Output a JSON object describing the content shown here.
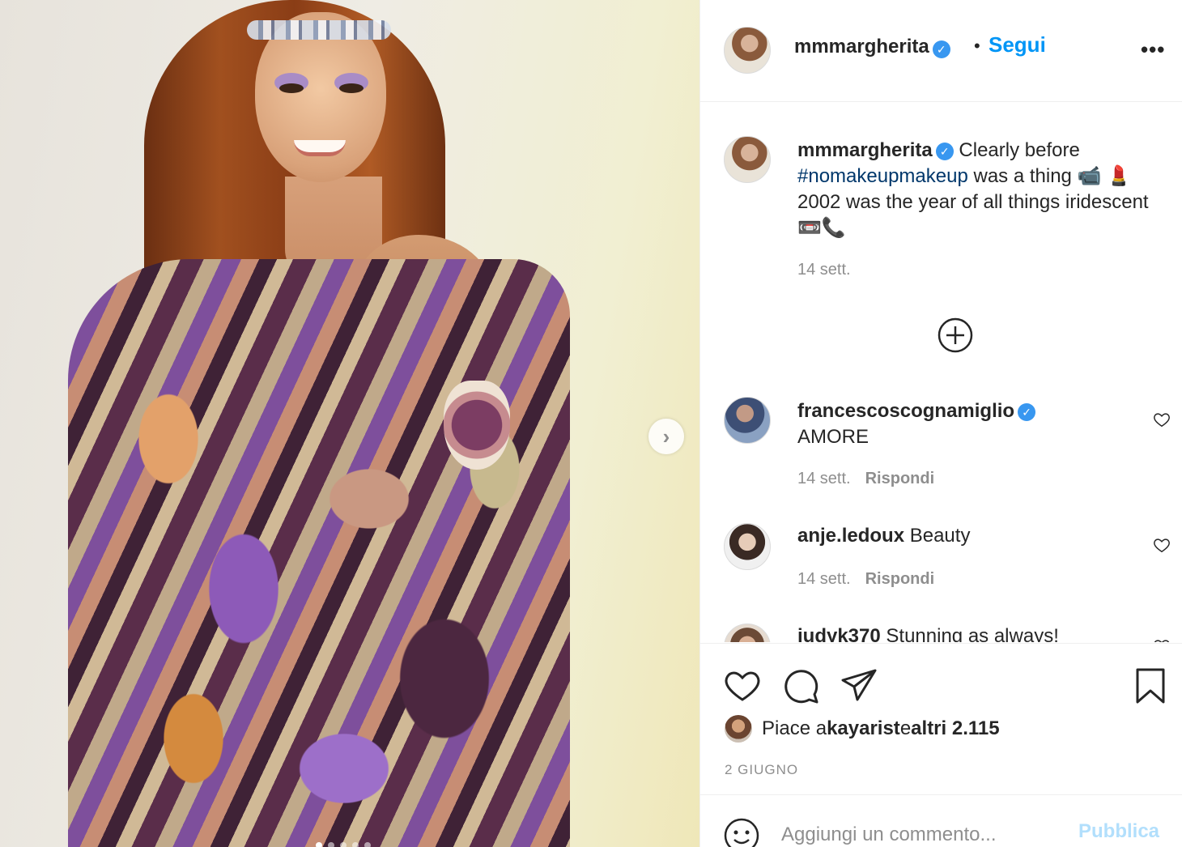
{
  "post": {
    "author": "mmmargherita",
    "follow_label": "Segui",
    "follow_separator": "•",
    "more_label": "•••",
    "verified_glyph": "✓",
    "next_glyph": "›"
  },
  "caption": {
    "username": "mmmargherita",
    "text_before": "Clearly before ",
    "hashtag": "#nomakeupmakeup",
    "text_after": " was a thing 📹 💄 2002 was the year of all things iridescent📼📞",
    "time": "14 sett."
  },
  "comments": [
    {
      "username": "francescoscognamiglio",
      "verified": true,
      "text": "AMORE",
      "time": "14 sett.",
      "reply_label": "Rispondi"
    },
    {
      "username": "anje.ledoux",
      "verified": false,
      "text": "Beauty",
      "time": "14 sett.",
      "reply_label": "Rispondi"
    },
    {
      "username": "judyk370",
      "verified": false,
      "text": "Stunning as always!"
    }
  ],
  "likes": {
    "prefix": "Piace a ",
    "user": "kayarist",
    "middle": " e ",
    "others": "altri 2.115"
  },
  "date": "2 GIUGNO",
  "composer": {
    "placeholder": "Aggiungi un commento...",
    "publish_label": "Pubblica"
  },
  "icons": {
    "verified": "verified-badge-icon",
    "more": "more-options-icon",
    "add": "add-circle-icon",
    "like": "heart-icon",
    "comment": "comment-bubble-icon",
    "share": "paper-plane-icon",
    "save": "bookmark-icon",
    "emoji": "smiley-icon",
    "next": "chevron-right-icon"
  },
  "colors": {
    "link": "#0095f6",
    "hashtag": "#00376b",
    "muted": "#8e8e8e",
    "verified": "#3897f0",
    "publish_disabled": "#b2dffc"
  }
}
